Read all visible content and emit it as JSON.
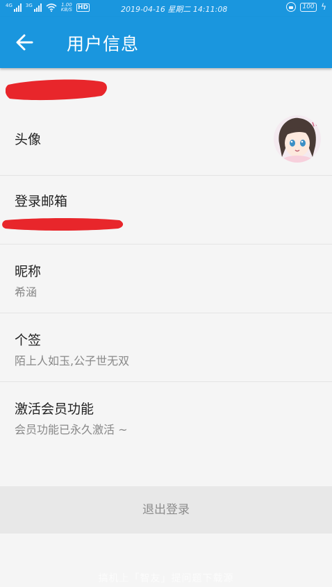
{
  "status_bar": {
    "net1": "4G",
    "net2": "3G",
    "speed_value": "1.00",
    "speed_unit": "KB/S",
    "hd": "HD",
    "datetime": "2019-04-16 星期二 14:11:08",
    "battery": "100"
  },
  "toolbar": {
    "back_icon": "arrow-left-icon",
    "title": "用户信息"
  },
  "rows": {
    "avatar": {
      "title": "头像"
    },
    "email": {
      "title": "登录邮箱"
    },
    "nickname": {
      "title": "昵称",
      "value": "希涵"
    },
    "signature": {
      "title": "个签",
      "value": "陌上人如玉,公子世无双"
    },
    "vip": {
      "title": "激活会员功能",
      "value": "会员功能已永久激活 ~"
    }
  },
  "logout_label": "退出登录",
  "watermark": "搞机上「智友」提问题下载源",
  "colors": {
    "accent": "#1a96de",
    "redaction": "#e8262b",
    "background": "#f5f5f5",
    "logout_bg": "#e8e8e8"
  }
}
